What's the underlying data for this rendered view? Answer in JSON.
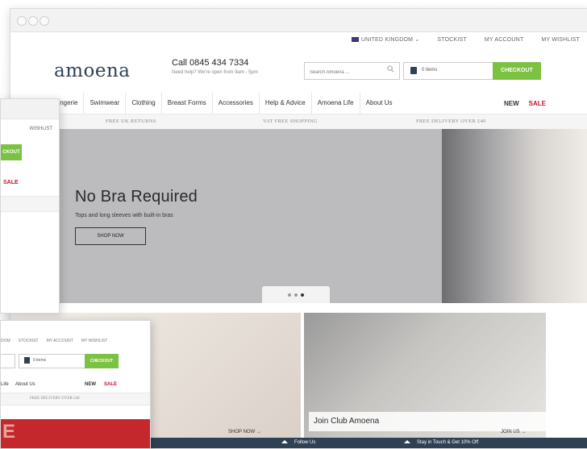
{
  "utility": {
    "country": "UNITED KINGDOM",
    "links": [
      "STOCKIST",
      "MY ACCOUNT",
      "MY WISHLIST"
    ]
  },
  "header": {
    "logo": "amoena",
    "call": "Call 0845 434 7334",
    "call_sub": "Need help? We're open from 9am - 5pm",
    "search_placeholder": "Search Amoena ...",
    "cart": "0 items",
    "checkout": "CHECKOUT"
  },
  "nav": {
    "items": [
      "Lingerie",
      "Swimwear",
      "Clothing",
      "Breast Forms",
      "Accessories",
      "Help & Advice",
      "Amoena Life",
      "About Us"
    ],
    "new": "NEW",
    "sale": "SALE"
  },
  "benefits": [
    "FREE UK RETURNS",
    "VAT FREE SHOPPING",
    "FREE DELIVERY OVER £40"
  ],
  "hero": {
    "title": "No Bra Required",
    "subtitle": "Tops and long sleeves with built-in bras",
    "cta": "SHOP NOW"
  },
  "tiles": {
    "left_link": "SHOP NOW →",
    "club_title": "Join Club Amoena",
    "club_link": "JOIN US →"
  },
  "footer": {
    "follow": "Follow Us",
    "signup": "Stay in Touch & Get 10% Off"
  },
  "window2": {
    "wishlist": "WISHLIST",
    "checkout": "CKOUT",
    "sale": "SALE"
  },
  "window3": {
    "util": [
      "DOM",
      "STOCKIST",
      "MY ACCOUNT",
      "MY WISHLIST"
    ],
    "cart": "0 items",
    "checkout": "CHECKOUT",
    "nav_a": "Life",
    "nav_b": "About Us",
    "new": "NEW",
    "sale": "SALE",
    "benefit": "FREE DELIVERY OVER £40",
    "banner_letter": "E"
  },
  "colors": {
    "accent_green": "#7cc242",
    "sale_red": "#c8102e",
    "navy": "#2f4255"
  }
}
